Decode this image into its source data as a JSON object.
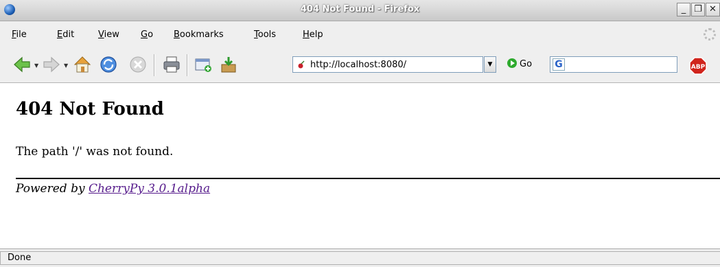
{
  "window": {
    "title": "404 Not Found - Firefox"
  },
  "menu": {
    "items": [
      {
        "label": "File",
        "accel": "F",
        "rest": "ile"
      },
      {
        "label": "Edit",
        "accel": "E",
        "rest": "dit"
      },
      {
        "label": "View",
        "accel": "V",
        "rest": "iew"
      },
      {
        "label": "Go",
        "accel": "G",
        "rest": "o"
      },
      {
        "label": "Bookmarks",
        "accel": "B",
        "rest": "ookmarks"
      },
      {
        "label": "Tools",
        "accel": "T",
        "rest": "ools"
      },
      {
        "label": "Help",
        "accel": "H",
        "rest": "elp"
      }
    ]
  },
  "toolbar": {
    "url": "http://localhost:8080/",
    "go_label": "Go",
    "search_engine_letter": "G",
    "adblock_label": "ABP"
  },
  "page": {
    "heading": "404 Not Found",
    "message": "The path '/' was not found.",
    "powered_prefix": "Powered by ",
    "powered_link": "CherryPy 3.0.1alpha"
  },
  "status": {
    "text": "Done"
  },
  "colors": {
    "link_visited": "#551a8b",
    "go_green": "#2eaa2e",
    "abp_red": "#d0241c"
  }
}
